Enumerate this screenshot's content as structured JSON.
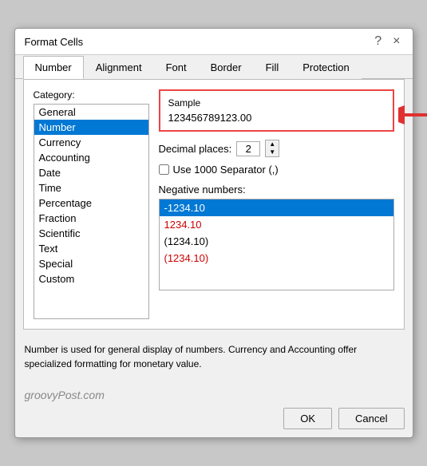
{
  "dialog": {
    "title": "Format Cells",
    "help_btn": "?",
    "close_btn": "×"
  },
  "tabs": [
    {
      "label": "Number",
      "active": true
    },
    {
      "label": "Alignment",
      "active": false
    },
    {
      "label": "Font",
      "active": false
    },
    {
      "label": "Border",
      "active": false
    },
    {
      "label": "Fill",
      "active": false
    },
    {
      "label": "Protection",
      "active": false
    }
  ],
  "category": {
    "label": "Category:",
    "items": [
      {
        "label": "General"
      },
      {
        "label": "Number",
        "selected": true
      },
      {
        "label": "Currency"
      },
      {
        "label": "Accounting"
      },
      {
        "label": "Date"
      },
      {
        "label": "Time"
      },
      {
        "label": "Percentage"
      },
      {
        "label": "Fraction"
      },
      {
        "label": "Scientific"
      },
      {
        "label": "Text"
      },
      {
        "label": "Special"
      },
      {
        "label": "Custom"
      }
    ]
  },
  "sample": {
    "label": "Sample",
    "value": "123456789123.00"
  },
  "decimal": {
    "label": "Decimal places:",
    "value": "2"
  },
  "separator": {
    "label": "Use 1000 Separator (,)"
  },
  "negative": {
    "label": "Negative numbers:",
    "items": [
      {
        "label": "-1234.10",
        "selected": true,
        "red": false
      },
      {
        "label": "1234.10",
        "selected": false,
        "red": true
      },
      {
        "label": "(1234.10)",
        "selected": false,
        "red": false
      },
      {
        "label": "(1234.10)",
        "selected": false,
        "red": true
      }
    ]
  },
  "description": "Number is used for general display of numbers.  Currency and Accounting offer specialized formatting for monetary value.",
  "watermark": "groovyPost.com",
  "buttons": {
    "ok": "OK",
    "cancel": "Cancel"
  }
}
